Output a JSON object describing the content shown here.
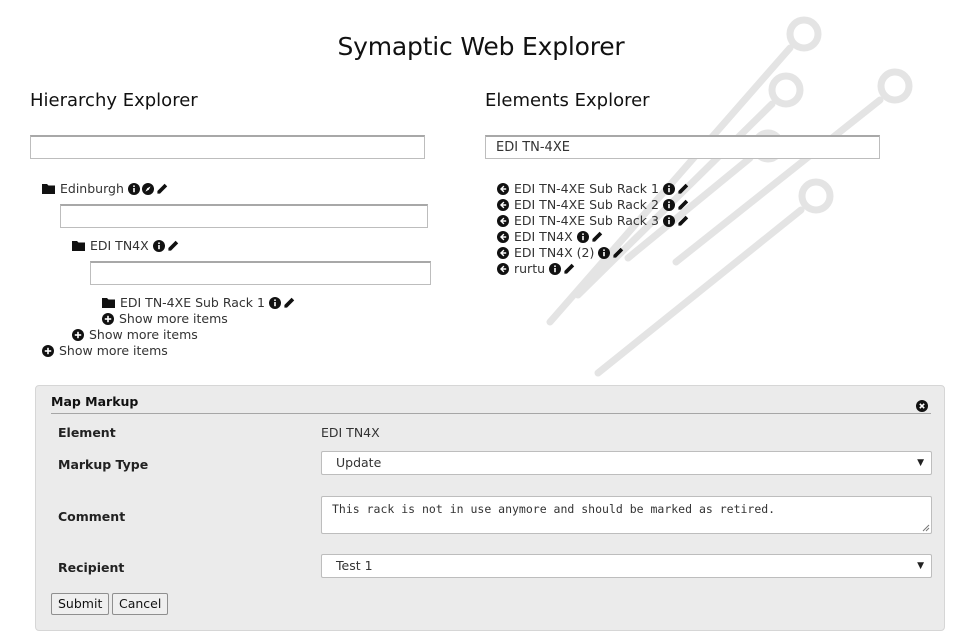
{
  "app": {
    "title": "Symaptic Web Explorer"
  },
  "hierarchy": {
    "title": "Hierarchy Explorer",
    "search_value": "",
    "root": {
      "label": "Edinburgh"
    },
    "child": {
      "label": "EDI TN4X"
    },
    "grandchild": {
      "label": "EDI TN-4XE Sub Rack 1"
    },
    "show_more": "Show more items"
  },
  "elements": {
    "title": "Elements Explorer",
    "search_value": "EDI TN-4XE",
    "items": [
      {
        "label": "EDI TN-4XE Sub Rack 1"
      },
      {
        "label": "EDI TN-4XE Sub Rack 2"
      },
      {
        "label": "EDI TN-4XE Sub Rack 3"
      },
      {
        "label": "EDI TN4X"
      },
      {
        "label": "EDI TN4X (2)"
      },
      {
        "label": "rurtu"
      }
    ]
  },
  "markup": {
    "title": "Map Markup",
    "element_label": "Element",
    "element_value": "EDI TN4X",
    "type_label": "Markup Type",
    "type_value": "Update",
    "comment_label": "Comment",
    "comment_value": "This rack is not in use anymore and should be marked as retired.",
    "recipient_label": "Recipient",
    "recipient_value": "Test 1",
    "submit_label": "Submit",
    "cancel_label": "Cancel"
  },
  "icons": {
    "folder": "folder-icon",
    "info": "info-icon",
    "compass": "compass-icon",
    "edit": "pencil-icon",
    "expand": "plus-circle-icon",
    "goto": "arrow-circle-left-icon",
    "close": "close-circle-icon",
    "dropdown": "chevron-down-icon"
  },
  "colors": {
    "accent_dark": "#111111",
    "panel_bg": "#ebebeb",
    "decoration": "#e6e6e6"
  }
}
